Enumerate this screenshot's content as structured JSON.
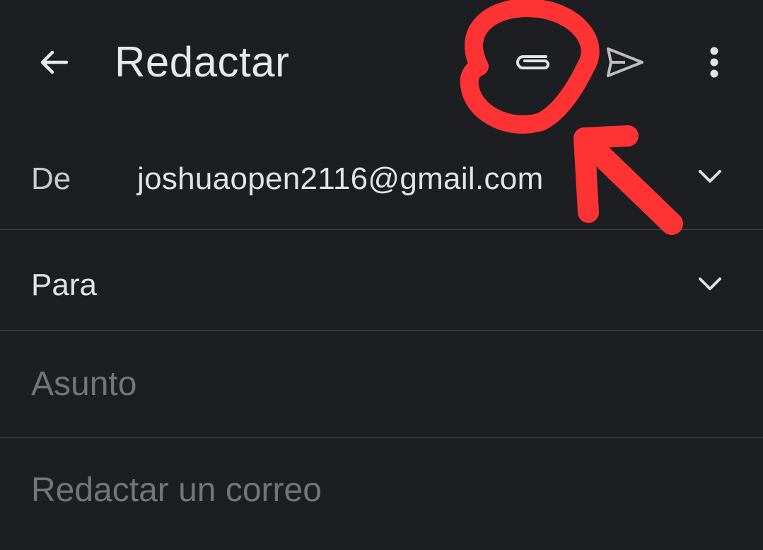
{
  "header": {
    "title": "Redactar",
    "back_icon": "arrow-left-icon",
    "attach_icon": "paperclip-icon",
    "send_icon": "send-icon",
    "more_icon": "more-vert-icon"
  },
  "fields": {
    "from_label": "De",
    "from_value": "joshuaopen2116@gmail.com",
    "to_label": "Para",
    "subject_placeholder": "Asunto",
    "body_placeholder": "Redactar un correo"
  },
  "colors": {
    "background": "#1c1e21",
    "divider": "#44474b",
    "annotation": "#ff3333"
  }
}
